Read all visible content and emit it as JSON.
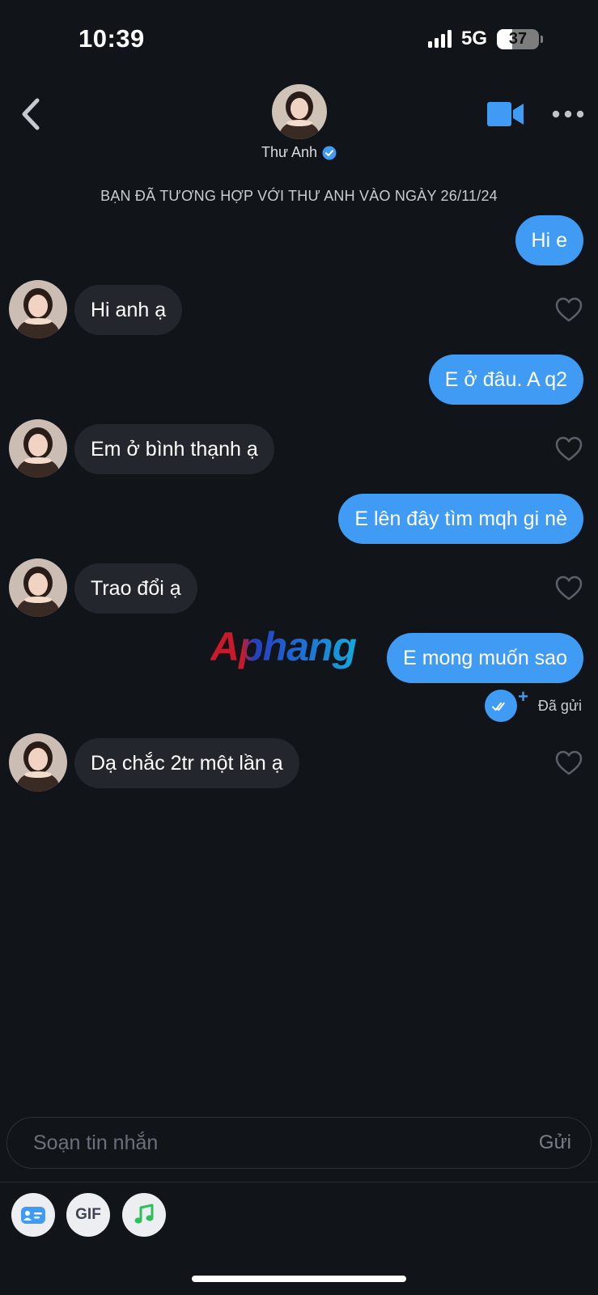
{
  "status_bar": {
    "time": "10:39",
    "network": "5G",
    "battery": "37"
  },
  "header": {
    "contact_name": "Thư Anh",
    "verified": true
  },
  "match_line": "BẠN ĐÃ TƯƠNG HỢP VỚI THƯ ANH VÀO NGÀY 26/11/24",
  "messages": [
    {
      "from": "me",
      "text": "Hi e"
    },
    {
      "from": "them",
      "text": "Hi anh ạ"
    },
    {
      "from": "me",
      "text": "E ở đâu. A q2"
    },
    {
      "from": "them",
      "text": "Em ở bình thạnh ạ"
    },
    {
      "from": "me",
      "text": "E lên đây tìm mqh gi nè"
    },
    {
      "from": "them",
      "text": "Trao đổi ạ"
    },
    {
      "from": "me",
      "text": "E mong muốn sao"
    },
    {
      "from": "them",
      "text": "Dạ chắc 2tr một lần ạ"
    }
  ],
  "sent_status": "Đã gửi",
  "watermark": "Aphang",
  "composer": {
    "placeholder": "Soạn tin nhắn",
    "send_label": "Gửi"
  },
  "tools": {
    "gif_label": "GIF"
  },
  "colors": {
    "sent_bubble": "#3f9bf3",
    "received_bubble": "#23262d",
    "background": "#111419"
  }
}
